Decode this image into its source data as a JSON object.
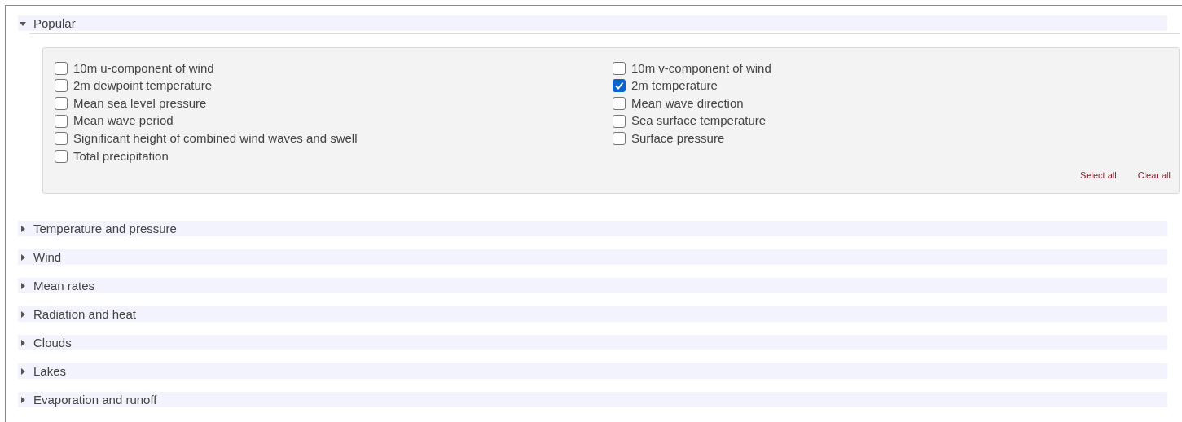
{
  "sections": [
    {
      "title": "Popular",
      "expanded": true,
      "columns": [
        [
          {
            "label": "10m u-component of wind",
            "checked": false
          },
          {
            "label": "2m dewpoint temperature",
            "checked": false
          },
          {
            "label": "Mean sea level pressure",
            "checked": false
          },
          {
            "label": "Mean wave period",
            "checked": false
          },
          {
            "label": "Significant height of combined wind waves and swell",
            "checked": false
          },
          {
            "label": "Total precipitation",
            "checked": false
          }
        ],
        [
          {
            "label": "10m v-component of wind",
            "checked": false
          },
          {
            "label": "2m temperature",
            "checked": true
          },
          {
            "label": "Mean wave direction",
            "checked": false
          },
          {
            "label": "Sea surface temperature",
            "checked": false
          },
          {
            "label": "Surface pressure",
            "checked": false
          }
        ]
      ],
      "links": [
        "Select all",
        "Clear all"
      ]
    },
    {
      "title": "Temperature and pressure",
      "expanded": false
    },
    {
      "title": "Wind",
      "expanded": false
    },
    {
      "title": "Mean rates",
      "expanded": false
    },
    {
      "title": "Radiation and heat",
      "expanded": false
    },
    {
      "title": "Clouds",
      "expanded": false
    },
    {
      "title": "Lakes",
      "expanded": false
    },
    {
      "title": "Evaporation and runoff",
      "expanded": false
    }
  ]
}
